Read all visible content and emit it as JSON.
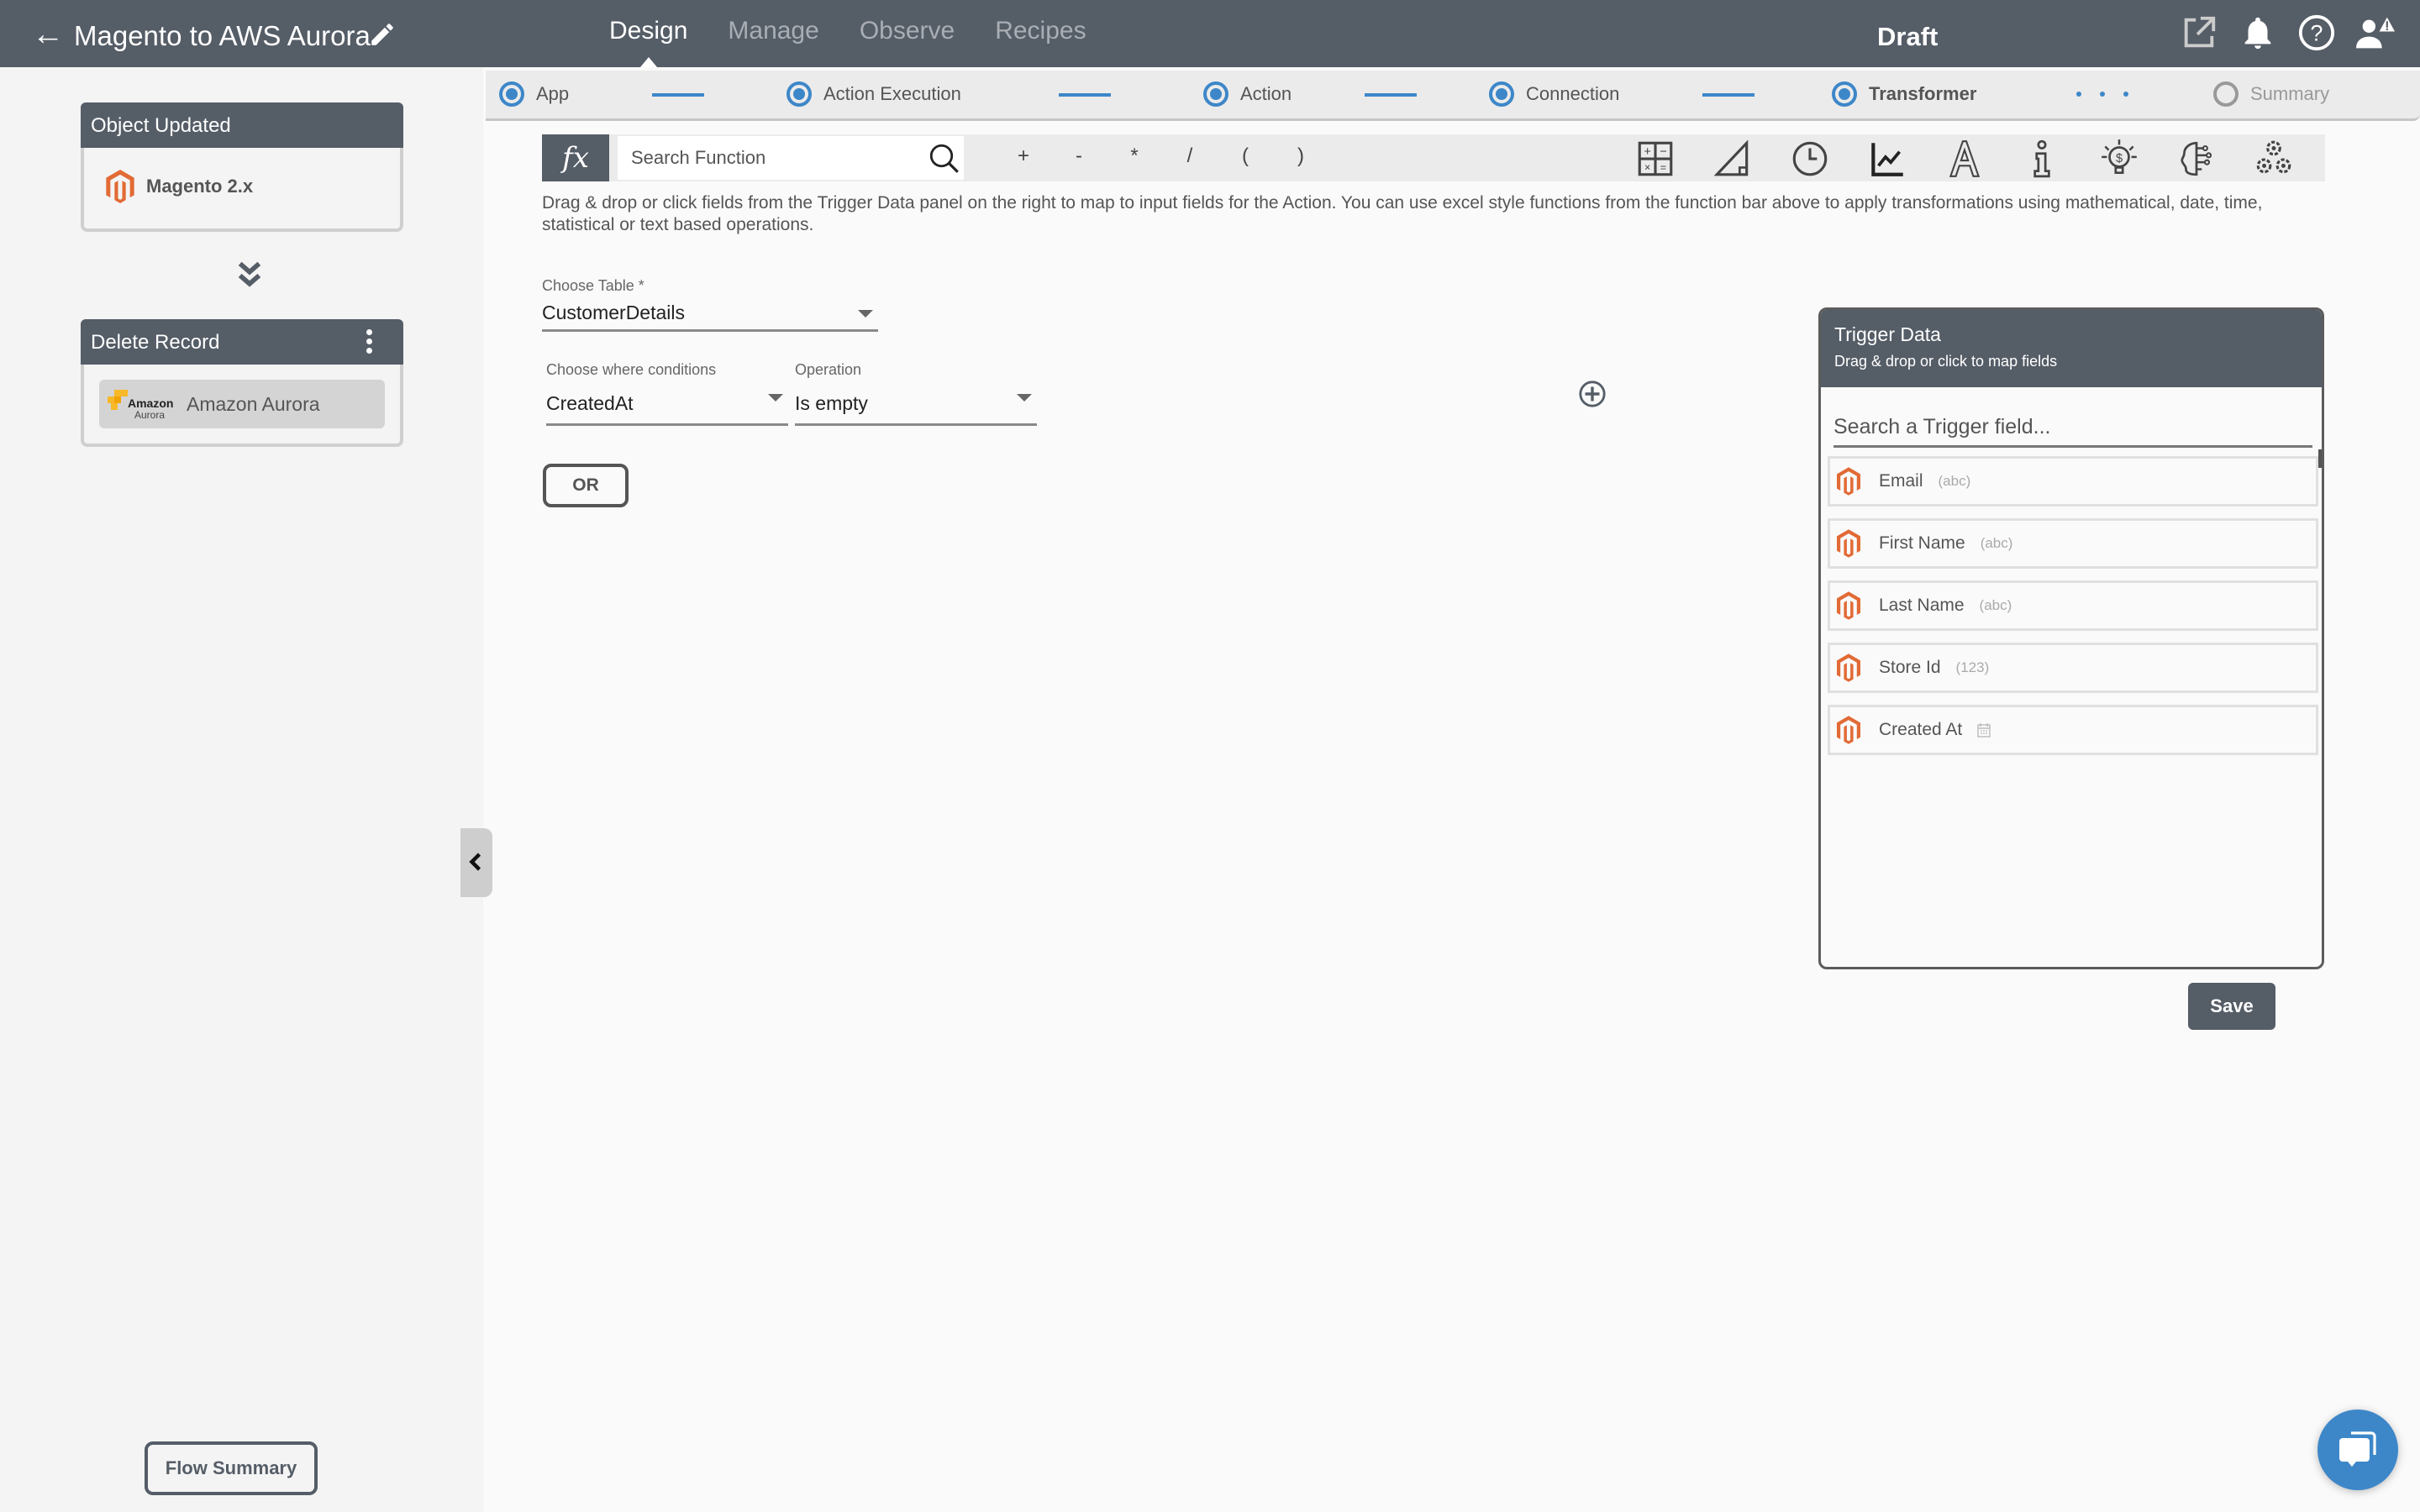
{
  "header": {
    "back_icon": "arrow-left-icon",
    "flow_title": "Magento to AWS Aurora",
    "edit_icon": "pencil-icon",
    "tabs": [
      {
        "label": "Design",
        "active": true
      },
      {
        "label": "Manage",
        "active": false
      },
      {
        "label": "Observe",
        "active": false
      },
      {
        "label": "Recipes",
        "active": false
      }
    ],
    "status": "Draft",
    "icons": [
      "external-link-icon",
      "bell-icon",
      "help-icon",
      "user-alert-icon"
    ]
  },
  "sidebar": {
    "trigger_card": {
      "title": "Object Updated",
      "app": "Magento 2.x",
      "app_icon": "magento-logo"
    },
    "connector_icon": "double-chevron-down-icon",
    "action_card": {
      "title": "Delete Record",
      "app": "Amazon Aurora",
      "logo_line1": "Amazon",
      "logo_line2": "Aurora",
      "menu_icon": "kebab-menu-icon"
    },
    "flow_summary_label": "Flow Summary",
    "collapse_icon": "chevron-left-icon"
  },
  "stepper": {
    "steps": [
      {
        "label": "App",
        "state": "done"
      },
      {
        "label": "Action Execution",
        "state": "done"
      },
      {
        "label": "Action",
        "state": "done"
      },
      {
        "label": "Connection",
        "state": "done"
      },
      {
        "label": "Transformer",
        "state": "current"
      },
      {
        "label": "Summary",
        "state": "pending"
      }
    ]
  },
  "function_bar": {
    "fx_label": "fx",
    "search_placeholder": "Search Function",
    "operators": [
      "+",
      "-",
      "*",
      "/",
      "(",
      ")"
    ],
    "categories": [
      "math-icon",
      "trigonometry-icon",
      "clock-icon",
      "statistics-chart-icon",
      "text-icon",
      "info-icon",
      "finance-bulb-icon",
      "ai-brain-icon",
      "settings-gears-icon"
    ]
  },
  "help_text": "Drag & drop or click fields from the Trigger Data panel on the right to map to input fields for the Action. You can use excel style functions from the function bar above to apply transformations using mathematical, date, time, statistical or text based operations.",
  "form": {
    "table": {
      "label": "Choose Table *",
      "value": "CustomerDetails"
    },
    "where": {
      "label": "Choose where conditions",
      "value": "CreatedAt"
    },
    "operation": {
      "label": "Operation",
      "value": "Is empty"
    },
    "or_label": "OR",
    "add_condition_icon": "plus-circle-icon"
  },
  "trigger_panel": {
    "title": "Trigger Data",
    "subtitle": "Drag & drop or click to map fields",
    "search_placeholder": "Search a Trigger field...",
    "fields": [
      {
        "name": "Email",
        "type": "(abc)"
      },
      {
        "name": "First Name",
        "type": "(abc)"
      },
      {
        "name": "Last Name",
        "type": "(abc)"
      },
      {
        "name": "Store Id",
        "type": "(123)"
      },
      {
        "name": "Created At",
        "type": "calendar-icon"
      }
    ]
  },
  "save_label": "Save",
  "chat_icon": "chat-bubble-icon",
  "colors": {
    "header_bg": "#555d67",
    "accent": "#3d87c9",
    "magento": "#e26a35",
    "aurora": "#f7b928"
  }
}
